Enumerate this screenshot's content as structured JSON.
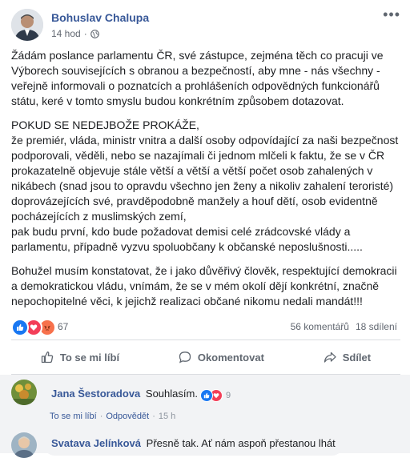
{
  "post": {
    "author": "Bohuslav Chalupa",
    "time": "14 hod",
    "audience_icon": "globe-icon",
    "more_icon": "ellipsis-icon",
    "paragraphs": [
      "Žádám poslance parlamentu ČR, své zástupce, zejména těch co pracuji ve Výborech souvisejících s obranou a bezpečností, aby mne - nás všechny - veřejně informovali o poznatcích a prohlášeních odpovědných funkcionářů státu, keré v tomto smyslu budou konkrétním způsobem dotazovat.",
      "POKUD SE NEDEJBOŽE PROKÁŽE,\nže premiér, vláda, ministr vnitra a další osoby odpovídající za naši bezpečnost podporovali, věděli, nebo se nazajímali či jednom mlčeli k faktu, že se v ČR prokazatelně objevuje stále větší a větší a větší počet osob zahalených v nikábech (snad jsou to opravdu všechno jen ženy a nikoliv zahalení teroristé) doprovázejících své, pravděpodobně manžely a houf dětí, osob evidentně pocházejících z muslimských zemí,\npak budu první, kdo bude požadovat demisi celé zrádcovské vlády a parlamentu, případně vyzvu spoluobčany k občanské neposlušnosti.....",
      "Bohužel musím konstatovat, že i jako důvěřivý člověk, respektující demokracii a demokratickou vládu, vnímám, že se v mém okolí dějí konkrétní, značně nepochopitelné věci, k jejichž realizaci občané nikomu nedali mandát!!!"
    ]
  },
  "reactions": {
    "count": "67",
    "comments": "56 komentářů",
    "shares": "18 sdílení"
  },
  "actions": {
    "like": "To se mi líbí",
    "comment": "Okomentovat",
    "share": "Sdílet"
  },
  "comments": [
    {
      "name": "Jana Šestoradova",
      "text": "Souhlasím.",
      "reaction_count": "9",
      "like_label": "To se mi líbí",
      "reply_label": "Odpovědět",
      "time": "15 h"
    },
    {
      "name": "Svatava Jelínková",
      "text": "Přesně tak. Ať nám aspoň přestanou lhát"
    }
  ],
  "colors": {
    "link_blue": "#385898",
    "like_blue": "#1877f2",
    "love_red": "#f33e58",
    "angry_orange": "#f7714c"
  }
}
